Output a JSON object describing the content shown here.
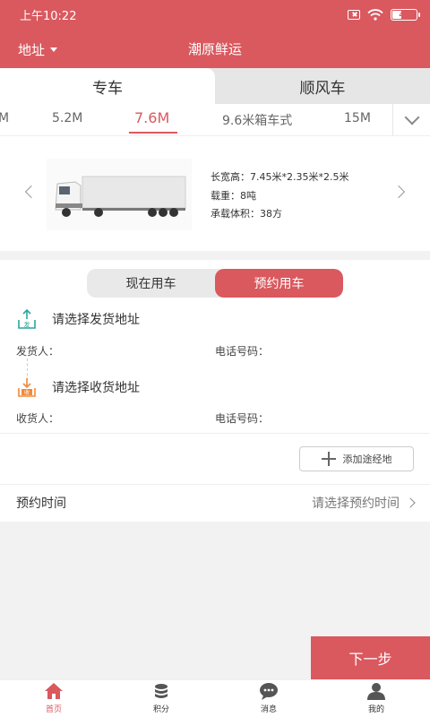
{
  "status": {
    "time": "上午10:22",
    "battery": "40"
  },
  "header": {
    "location_label": "地址",
    "title": "潮原鲜运"
  },
  "tabs": [
    {
      "label": "专车",
      "active": true
    },
    {
      "label": "顺风车",
      "active": false
    }
  ],
  "sizes": [
    {
      "label": "M"
    },
    {
      "label": "5.2M"
    },
    {
      "label": "7.6M",
      "active": true
    },
    {
      "label": "9.6米箱车式"
    },
    {
      "label": "15M"
    }
  ],
  "vehicle": {
    "dimensions": "长宽高：7.45米*2.35米*2.5米",
    "load": "载重：8吨",
    "volume": "承载体积：38方"
  },
  "modes": [
    {
      "label": "现在用车",
      "active": false
    },
    {
      "label": "预约用车",
      "active": true
    }
  ],
  "shipper": {
    "address_prompt": "请选择发货地址",
    "icon_text": "发",
    "person_label": "发货人：",
    "phone_label": "电话号码："
  },
  "receiver": {
    "address_prompt": "请选择收货地址",
    "icon_text": "收",
    "person_label": "收货人：",
    "phone_label": "电话号码："
  },
  "waypoint_button": "添加途经地",
  "booking_time": {
    "label": "预约时间",
    "placeholder": "请选择预约时间"
  },
  "next_button": "下一步",
  "nav": [
    {
      "label": "首页",
      "icon": "home-icon",
      "active": true
    },
    {
      "label": "积分",
      "icon": "coins-icon",
      "active": false
    },
    {
      "label": "消息",
      "icon": "message-icon",
      "active": false
    },
    {
      "label": "我的",
      "icon": "user-icon",
      "active": false
    }
  ],
  "colors": {
    "accent": "#d9595f",
    "shipper_icon": "#2aa6a0",
    "receiver_icon": "#f08a3c"
  }
}
